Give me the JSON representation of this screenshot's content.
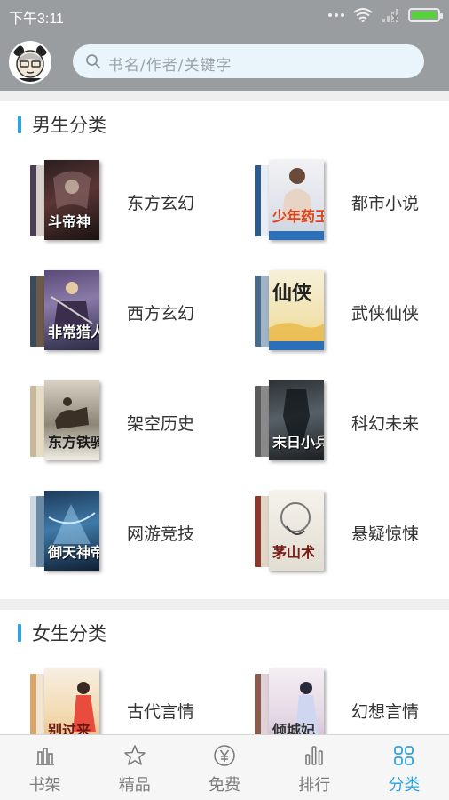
{
  "status_bar": {
    "time": "下午3:11"
  },
  "search": {
    "placeholder": "书名/作者/关键字"
  },
  "male_section": {
    "title": "男生分类",
    "categories": [
      {
        "name": "东方玄幻",
        "cover_text": "斗帝神"
      },
      {
        "name": "都市小说",
        "cover_text": "少年药王"
      },
      {
        "name": "西方玄幻",
        "cover_text": "非常猎人"
      },
      {
        "name": "武侠仙侠",
        "cover_text": "仙侠"
      },
      {
        "name": "架空历史",
        "cover_text": "东方铁骑"
      },
      {
        "name": "科幻未来",
        "cover_text": "末日小兵"
      },
      {
        "name": "网游竞技",
        "cover_text": "御天神帝"
      },
      {
        "name": "悬疑惊悚",
        "cover_text": "茅山术"
      }
    ]
  },
  "female_section": {
    "title": "女生分类",
    "categories": [
      {
        "name": "古代言情",
        "cover_text": "别过来"
      },
      {
        "name": "幻想言情",
        "cover_text": "倾城妃"
      }
    ]
  },
  "tabbar": {
    "items": [
      {
        "label": "书架",
        "icon": "bookshelf-icon"
      },
      {
        "label": "精品",
        "icon": "star-icon"
      },
      {
        "label": "免费",
        "icon": "yen-icon"
      },
      {
        "label": "排行",
        "icon": "ranking-icon"
      },
      {
        "label": "分类",
        "icon": "grid-icon"
      }
    ],
    "active": "分类"
  },
  "colors": {
    "accent": "#2fa3df",
    "header": "#9a9d9f"
  }
}
